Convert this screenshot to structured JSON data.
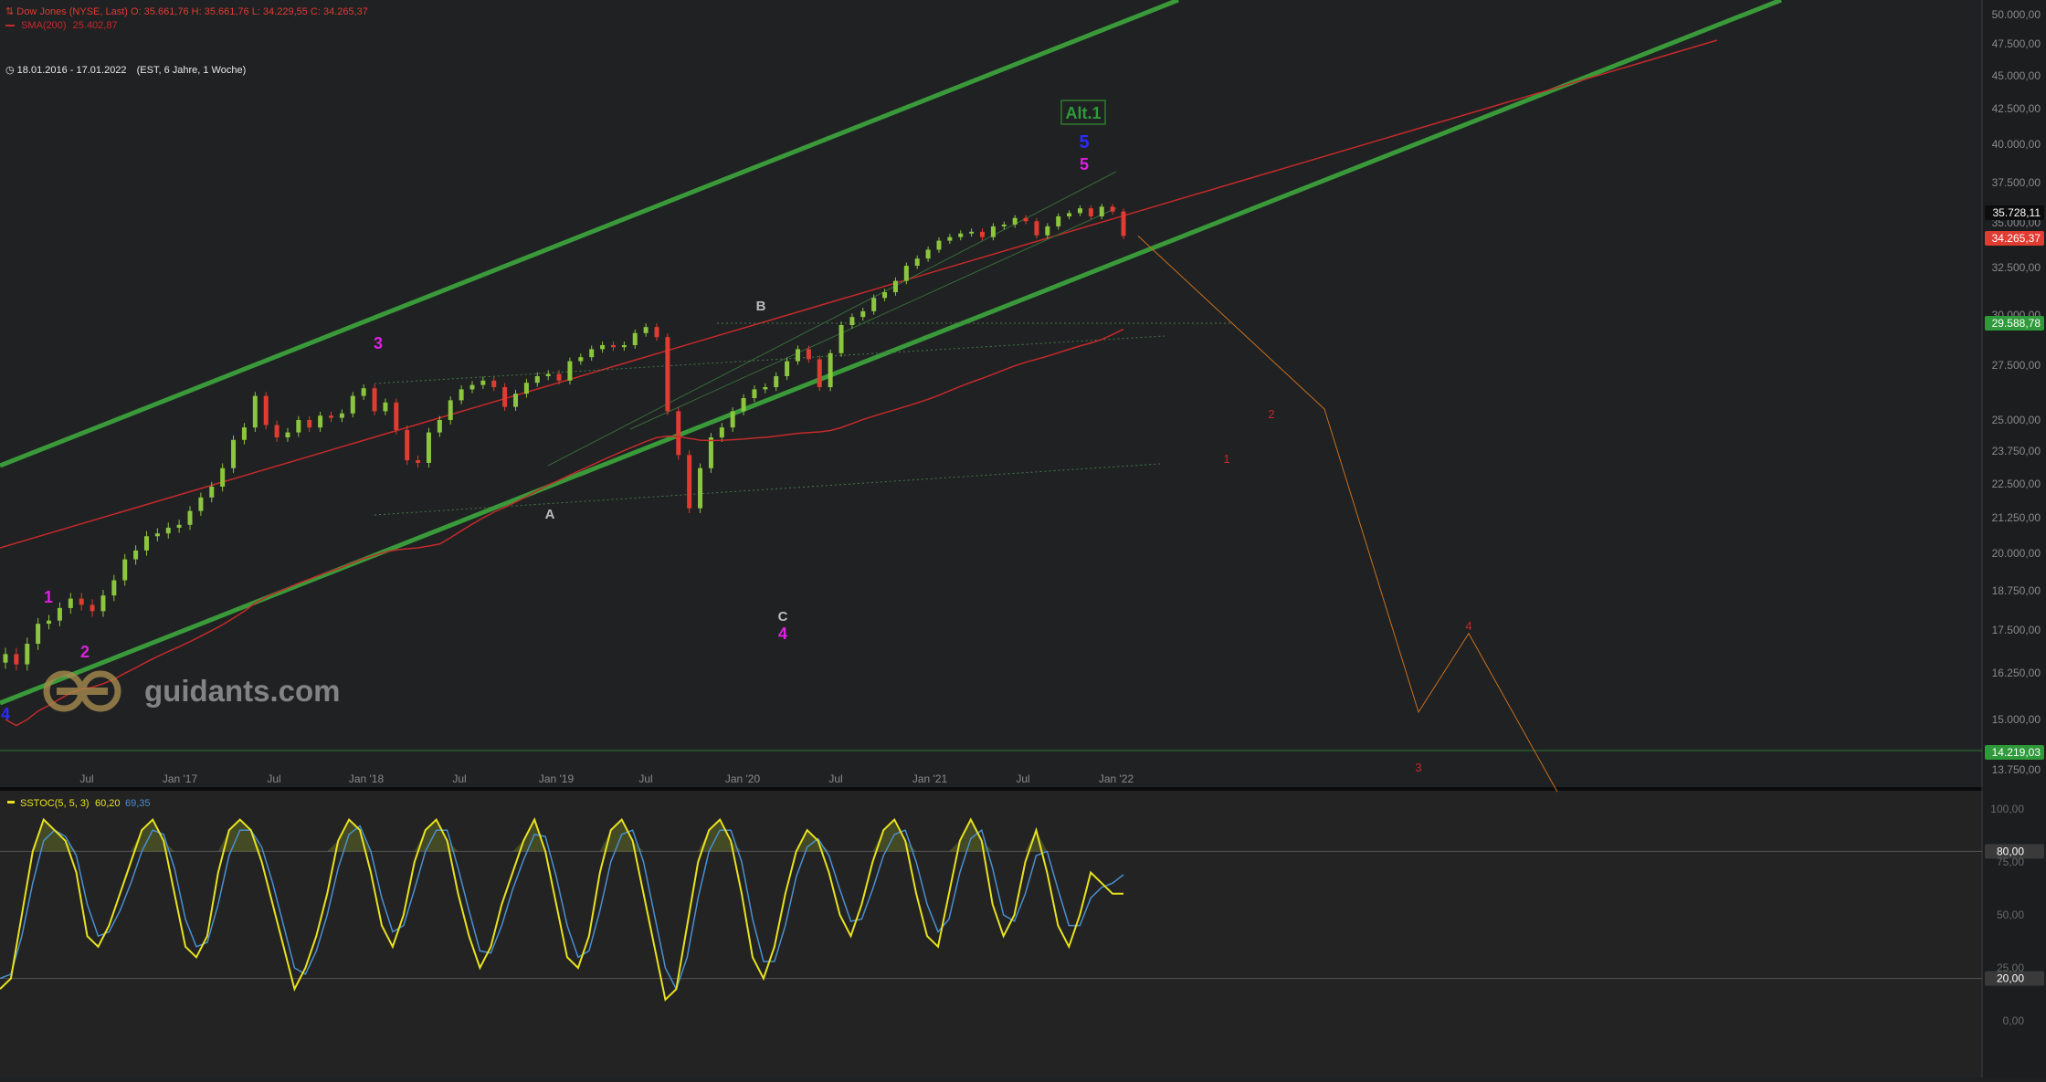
{
  "header": {
    "instrument_line": "Dow Jones (NYSE, Last)  O: 35.661,76  H: 35.661,76  L: 34.229,55  C: 34.265,37",
    "sma_label": "SMA(200)",
    "sma_value": "25.402,87",
    "date_range": "18.01.2016 - 17.01.2022",
    "range_info": "(EST, 6 Jahre, 1 Woche)"
  },
  "watermark": {
    "text": "guidants.com"
  },
  "colors": {
    "background": "#1e2022",
    "channel_green": "#3a9a3a",
    "sma_red": "#c62a2a",
    "bull_candle": "#8cc63f",
    "bear_candle": "#e03c31",
    "stoch_k": "#e8e21e",
    "stoch_d": "#4a8fd0",
    "projection": "#c8701e"
  },
  "chart_data": [
    {
      "type": "candlestick",
      "title": "Dow Jones (NYSE, Last)",
      "price_axis_ticks": [
        "50.000,00",
        "47.500,00",
        "45.000,00",
        "42.500,00",
        "40.000,00",
        "37.500,00",
        "35.000,00",
        "32.500,00",
        "30.000,00",
        "27.500,00",
        "25.000,00",
        "23.750,00",
        "22.500,00",
        "21.250,00",
        "20.000,00",
        "18.750,00",
        "17.500,00",
        "16.250,00",
        "15.000,00",
        "13.750,00"
      ],
      "time_axis_ticks": [
        "Jul",
        "Jan '17",
        "Jul",
        "Jan '18",
        "Jul",
        "Jan '19",
        "Jul",
        "Jan '20",
        "Jul",
        "Jan '21",
        "Jul",
        "Jan '22"
      ],
      "price_tags": [
        {
          "label": "35.728,11",
          "color": "#000000"
        },
        {
          "label": "34.265,37",
          "color": "#e03c31"
        },
        {
          "label": "29.588,78",
          "color": "#2e9a3a"
        },
        {
          "label": "14.219,03",
          "color": "#2e9a3a"
        }
      ],
      "series_close": [
        16800,
        16500,
        17100,
        17700,
        17800,
        18200,
        18500,
        18300,
        18100,
        18600,
        19100,
        19800,
        20100,
        20600,
        20700,
        20900,
        21000,
        21500,
        22000,
        22400,
        23100,
        24200,
        24700,
        26100,
        24800,
        24300,
        24500,
        25000,
        24700,
        25200,
        25100,
        25300,
        26100,
        26450,
        25400,
        25800,
        24600,
        23400,
        23300,
        24500,
        25000,
        25900,
        26400,
        26600,
        26800,
        26500,
        25600,
        26200,
        26700,
        27000,
        27100,
        26800,
        27700,
        27900,
        28300,
        28500,
        28400,
        28500,
        29100,
        29400,
        28900,
        25400,
        23600,
        21600,
        23100,
        24300,
        24700,
        25400,
        26000,
        26400,
        26500,
        27000,
        27700,
        28300,
        27800,
        26500,
        28100,
        29500,
        29900,
        30200,
        30900,
        31200,
        31800,
        32600,
        33000,
        33500,
        34000,
        34200,
        34400,
        34500,
        34200,
        34800,
        34900,
        35300,
        35100,
        34300,
        34800,
        35400,
        35600,
        35900,
        35400,
        36000,
        35700,
        34265
      ],
      "sma200": "25.402,87",
      "wave_labels": [
        "1",
        "2",
        "3",
        "4",
        "5",
        "5",
        "A",
        "B",
        "C",
        "Alt.1"
      ],
      "projection_labels": [
        "1",
        "2",
        "3",
        "4"
      ],
      "projection_path": [
        34265,
        25500,
        15200,
        17400,
        13200
      ]
    },
    {
      "type": "line",
      "title": "SSTOC(5, 5, 3)",
      "header_values": [
        "60,20",
        "69,35"
      ],
      "axis_ticks": [
        "100,00",
        "75,00",
        "50,00",
        "25,00",
        "0,00"
      ],
      "levels": [
        "80,00",
        "20,00"
      ],
      "ylim": [
        0,
        100
      ],
      "series": [
        {
          "name": "%K",
          "values": [
            15,
            20,
            50,
            80,
            95,
            90,
            85,
            70,
            40,
            35,
            45,
            60,
            75,
            90,
            95,
            85,
            60,
            35,
            30,
            40,
            70,
            90,
            95,
            90,
            75,
            55,
            35,
            15,
            25,
            40,
            60,
            85,
            95,
            90,
            70,
            45,
            35,
            50,
            75,
            90,
            95,
            85,
            60,
            40,
            25,
            35,
            55,
            70,
            85,
            95,
            80,
            55,
            30,
            25,
            40,
            70,
            90,
            95,
            85,
            60,
            35,
            10,
            15,
            45,
            75,
            90,
            95,
            85,
            60,
            30,
            20,
            35,
            60,
            80,
            90,
            85,
            70,
            50,
            40,
            55,
            75,
            90,
            95,
            85,
            60,
            40,
            35,
            60,
            85,
            95,
            85,
            55,
            40,
            50,
            75,
            90,
            70,
            45,
            35,
            50,
            70,
            65,
            60,
            60
          ]
        },
        {
          "name": "%D",
          "values": [
            20,
            22,
            40,
            65,
            85,
            90,
            87,
            78,
            55,
            40,
            42,
            52,
            65,
            80,
            90,
            88,
            72,
            48,
            35,
            37,
            55,
            78,
            90,
            90,
            82,
            65,
            45,
            25,
            22,
            33,
            50,
            72,
            88,
            92,
            80,
            58,
            42,
            45,
            62,
            80,
            90,
            90,
            72,
            52,
            33,
            32,
            45,
            62,
            76,
            88,
            87,
            68,
            45,
            30,
            33,
            52,
            75,
            88,
            90,
            75,
            50,
            25,
            15,
            30,
            58,
            80,
            90,
            90,
            75,
            48,
            28,
            28,
            45,
            68,
            82,
            86,
            78,
            62,
            47,
            48,
            62,
            78,
            88,
            90,
            75,
            55,
            42,
            48,
            70,
            86,
            90,
            72,
            50,
            47,
            60,
            78,
            80,
            62,
            45,
            45,
            58,
            63,
            65,
            69
          ]
        }
      ]
    }
  ]
}
